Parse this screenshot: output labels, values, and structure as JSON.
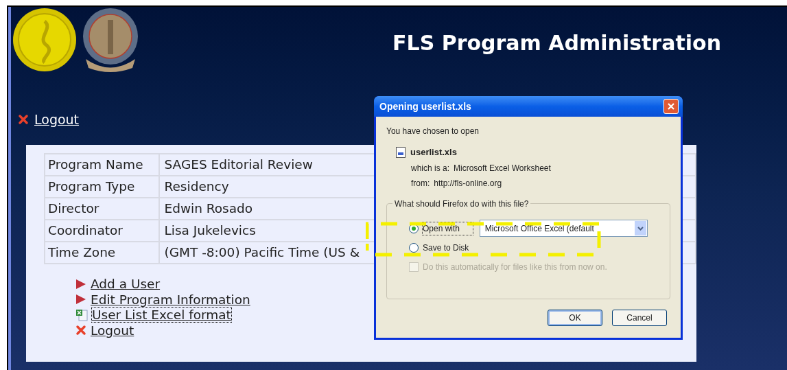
{
  "header": {
    "title": "FLS Program Administration"
  },
  "top_link": {
    "label": "Logout"
  },
  "program_table": {
    "rows": [
      {
        "label": "Program Name",
        "value": "SAGES Editorial Review"
      },
      {
        "label": "Program Type",
        "value": "Residency"
      },
      {
        "label": "Director",
        "value": "Edwin Rosado"
      },
      {
        "label": "Coordinator",
        "value": "Lisa Jukelevics"
      },
      {
        "label": "Time Zone",
        "value": "(GMT -8:00) Pacific Time (US &"
      }
    ]
  },
  "actions": [
    {
      "kind": "arrow",
      "label": "Add a User",
      "focused": false
    },
    {
      "kind": "arrow",
      "label": "Edit Program Information",
      "focused": false
    },
    {
      "kind": "excel",
      "label": "User List Excel format",
      "focused": true
    },
    {
      "kind": "close",
      "label": "Logout",
      "focused": false
    }
  ],
  "dialog": {
    "title": "Opening userlist.xls",
    "intro": "You have chosen to open",
    "file": {
      "name": "userlist.xls",
      "type_label": "which is a:",
      "type": "Microsoft Excel Worksheet",
      "from_label": "from:",
      "from": "http://fls-online.org"
    },
    "group": {
      "legend": "What should Firefox do with this file?",
      "options": [
        {
          "label": "Open with",
          "selected": true
        },
        {
          "label": "Save to Disk",
          "selected": false
        }
      ],
      "app_select": {
        "value": "Microsoft Office Excel (default"
      },
      "remember": {
        "label": "Do this automatically for files like this from now on.",
        "checked": false,
        "disabled": true
      }
    },
    "buttons": [
      {
        "label": "OK",
        "default": true
      },
      {
        "label": "Cancel",
        "default": false
      }
    ]
  }
}
